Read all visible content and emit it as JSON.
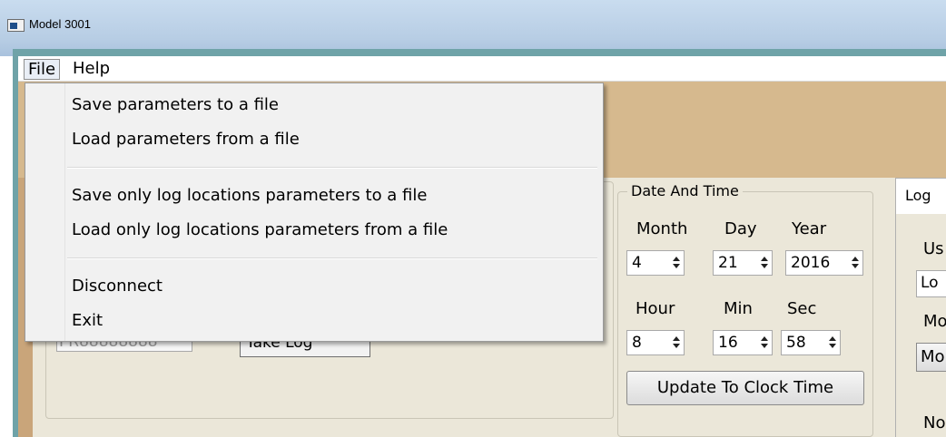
{
  "window": {
    "title": "Model 3001"
  },
  "menubar": {
    "file": "File",
    "help": "Help"
  },
  "file_menu": {
    "items": [
      "Save parameters to a file",
      "Load parameters from a file",
      "Save only log locations parameters to a file",
      "Load only log locations parameters from a file",
      "Disconnect",
      "Exit"
    ]
  },
  "background": {
    "partial_field_text": "PR88888888",
    "take_log_label": "Take Log"
  },
  "date_time": {
    "title": "Date And Time",
    "labels": {
      "month": "Month",
      "day": "Day",
      "year": "Year",
      "hour": "Hour",
      "min": "Min",
      "sec": "Sec"
    },
    "values": {
      "month": "4",
      "day": "21",
      "year": "2016",
      "hour": "8",
      "min": "16",
      "sec": "58"
    },
    "update_button": "Update To Clock Time"
  },
  "log_panel": {
    "tab_label": "Log",
    "partial_labels": [
      "Us",
      "Lo",
      "Mo",
      "Mo",
      "No"
    ]
  }
}
